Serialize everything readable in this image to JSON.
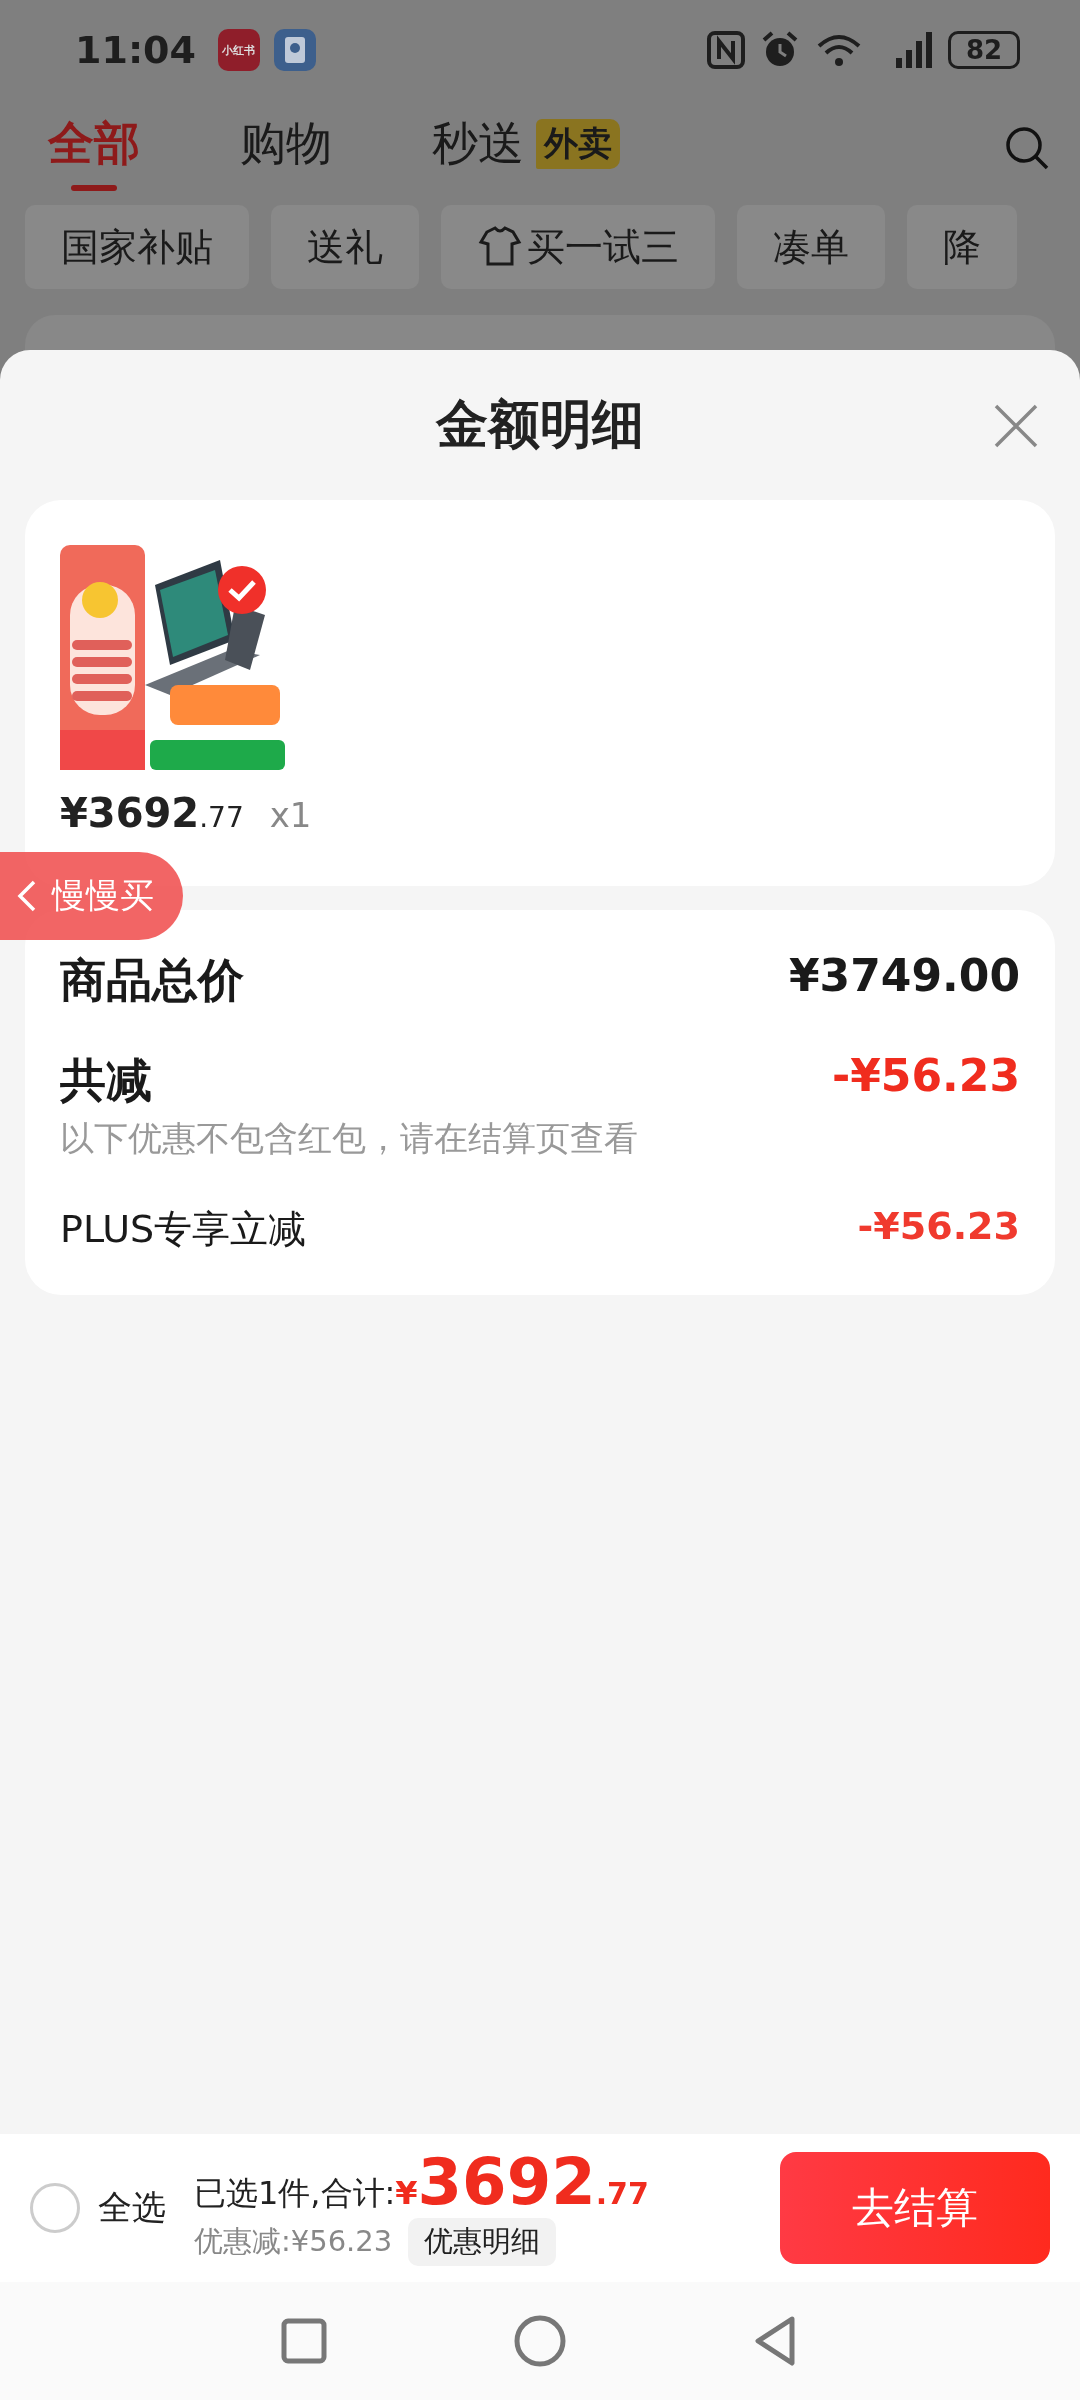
{
  "status_bar": {
    "time": "11:04",
    "app_badge": "小红书",
    "battery": "82"
  },
  "top_tabs": [
    {
      "label": "全部",
      "selected": true
    },
    {
      "label": "购物",
      "selected": false
    },
    {
      "label": "秒送",
      "selected": false,
      "badge": "外卖"
    }
  ],
  "filter_chips": [
    {
      "label": "国家补贴",
      "kind": "plain"
    },
    {
      "label": "送礼",
      "kind": "plain"
    },
    {
      "label": "买一试三",
      "kind": "icon"
    },
    {
      "label": "凑单",
      "kind": "plain"
    },
    {
      "label": "降",
      "kind": "plain"
    }
  ],
  "sheet": {
    "title": "金额明细",
    "product": {
      "price_main": "¥3692",
      "price_decimal": ".77",
      "quantity": "x1"
    },
    "floating_tag": {
      "label": "慢慢买"
    },
    "summary": [
      {
        "kind": "total",
        "label": "商品总价",
        "amount": "¥3749.00"
      },
      {
        "kind": "discount",
        "label": "共减",
        "note": "以下优惠不包含红包，请在结算页查看",
        "amount": "-¥56.23"
      },
      {
        "kind": "item",
        "label": "PLUS专享立减",
        "amount": "-¥56.23"
      }
    ]
  },
  "bottom_bar": {
    "select_all": {
      "label": "全选",
      "checked": false
    },
    "summary_label": "已选1件,合计:",
    "currency": "¥",
    "total_main": "3692",
    "total_decimal": ".77",
    "discount_label": "优惠减:¥56.23",
    "detail_button": "优惠明细",
    "checkout_button": "去结算"
  }
}
